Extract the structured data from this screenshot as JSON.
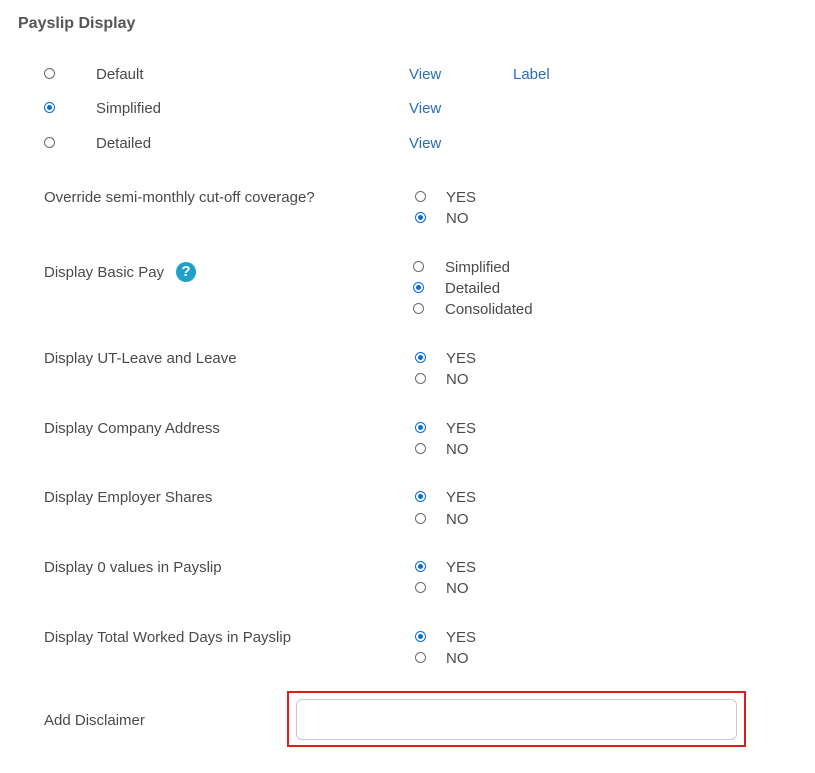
{
  "section_title": "Payslip Display",
  "payslip_options": [
    {
      "label": "Default",
      "view": "View",
      "label_link": "Label",
      "selected": false
    },
    {
      "label": "Simplified",
      "view": "View",
      "selected": true
    },
    {
      "label": "Detailed",
      "view": "View",
      "selected": false
    }
  ],
  "settings": [
    {
      "question": "Override semi-monthly cut-off coverage?",
      "options": [
        {
          "label": "YES",
          "selected": false
        },
        {
          "label": "NO",
          "selected": true
        }
      ]
    },
    {
      "question": "Display Basic Pay",
      "help": "?",
      "options": [
        {
          "label": "Simplified",
          "selected": false
        },
        {
          "label": "Detailed",
          "selected": true
        },
        {
          "label": "Consolidated",
          "selected": false
        }
      ]
    },
    {
      "question": "Display UT-Leave and Leave",
      "options": [
        {
          "label": "YES",
          "selected": true
        },
        {
          "label": "NO",
          "selected": false
        }
      ]
    },
    {
      "question": "Display Company Address",
      "options": [
        {
          "label": "YES",
          "selected": true
        },
        {
          "label": "NO",
          "selected": false
        }
      ]
    },
    {
      "question": "Display Employer Shares",
      "options": [
        {
          "label": "YES",
          "selected": true
        },
        {
          "label": "NO",
          "selected": false
        }
      ]
    },
    {
      "question": "Display 0 values in Payslip",
      "options": [
        {
          "label": "YES",
          "selected": true
        },
        {
          "label": "NO",
          "selected": false
        }
      ]
    },
    {
      "question": "Display Total Worked Days in Payslip",
      "options": [
        {
          "label": "YES",
          "selected": true
        },
        {
          "label": "NO",
          "selected": false
        }
      ]
    }
  ],
  "disclaimer": {
    "label": "Add Disclaimer",
    "value": "",
    "placeholder": ""
  },
  "colors": {
    "accent": "#0a6cdb",
    "link": "#2a6db3",
    "help": "#21a0c7",
    "highlight": "#e01b1b"
  }
}
